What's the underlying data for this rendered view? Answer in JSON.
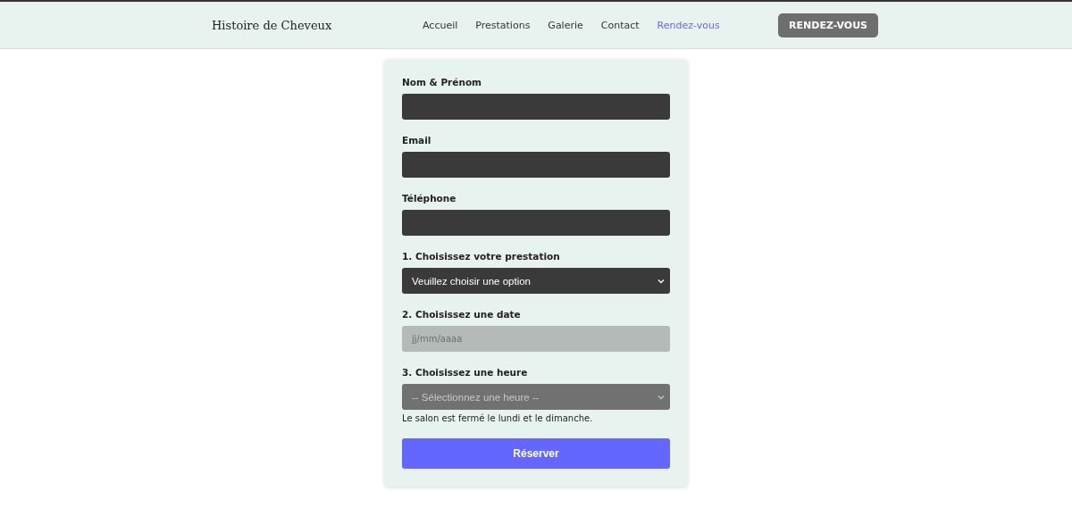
{
  "header": {
    "logo": "Histoire de Cheveux",
    "nav": [
      {
        "label": "Accueil",
        "selected": false
      },
      {
        "label": "Prestations",
        "selected": false
      },
      {
        "label": "Galerie",
        "selected": false
      },
      {
        "label": "Contact",
        "selected": false
      },
      {
        "label": "Rendez-vous",
        "selected": true
      }
    ],
    "cta": "RENDEZ-VOUS"
  },
  "form": {
    "fields": [
      {
        "kind": "text",
        "label": "Nom & Prénom",
        "disabled": false
      },
      {
        "kind": "text",
        "label": "Email",
        "disabled": false
      },
      {
        "kind": "text",
        "label": "Téléphone",
        "disabled": false
      },
      {
        "kind": "select",
        "label": "1. Choisissez votre prestation",
        "value": "Veuillez choisir une option",
        "disabled": false
      },
      {
        "kind": "date",
        "label": "2. Choisissez une date",
        "placeholder": "jj/mm/aaaa",
        "disabled": true
      },
      {
        "kind": "select",
        "label": "3. Choisissez une heure",
        "value": "-- Sélectionnez une heure --",
        "disabled": true,
        "note": "Le salon est fermé le lundi et le dimanche."
      }
    ],
    "submit": "Réserver"
  }
}
